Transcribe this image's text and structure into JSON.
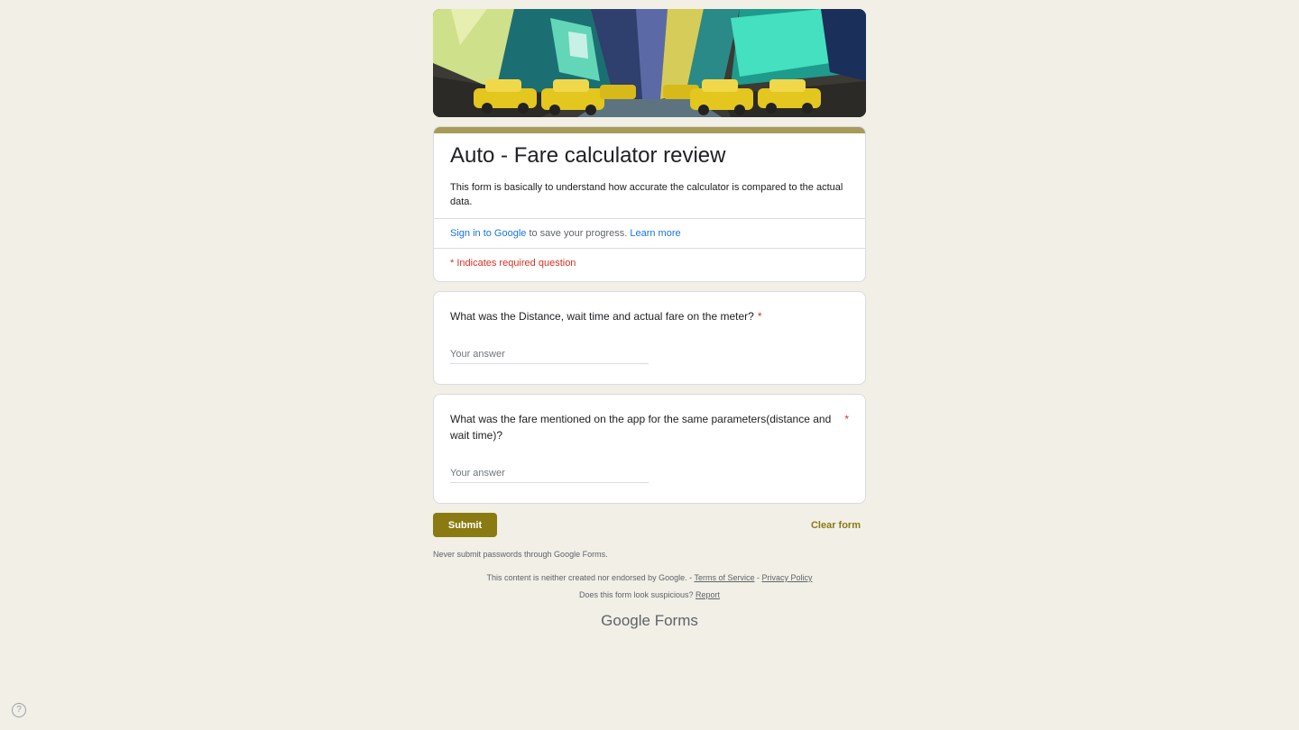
{
  "form": {
    "title": "Auto - Fare calculator review",
    "description": "This form is basically to understand how accurate the calculator is compared to the actual data.",
    "signin_link": "Sign in to Google",
    "signin_text": " to save your progress. ",
    "learn_more": "Learn more",
    "required_note": "* Indicates required question"
  },
  "questions": [
    {
      "text": "What was the Distance, wait time and actual fare on the meter?",
      "required_mark": "*",
      "placeholder": "Your answer"
    },
    {
      "text": "What was the fare mentioned on the app for the same parameters(distance and wait time)?",
      "required_mark": "*",
      "placeholder": "Your answer"
    }
  ],
  "actions": {
    "submit": "Submit",
    "clear": "Clear form"
  },
  "footer": {
    "never_submit": "Never submit passwords through Google Forms.",
    "disclaimer": "This content is neither created nor endorsed by Google. - ",
    "terms": "Terms of Service",
    "separator": " - ",
    "privacy": "Privacy Policy",
    "suspicious": "Does this form look suspicious? ",
    "report": "Report",
    "brand_google": "Google",
    "brand_forms": " Forms"
  },
  "icons": {
    "help": "help-icon"
  },
  "colors": {
    "accent": "#8a7a12",
    "title_bar": "#a89b5a",
    "background": "#f1efe6",
    "required": "#d93025",
    "link": "#1a73e8"
  }
}
